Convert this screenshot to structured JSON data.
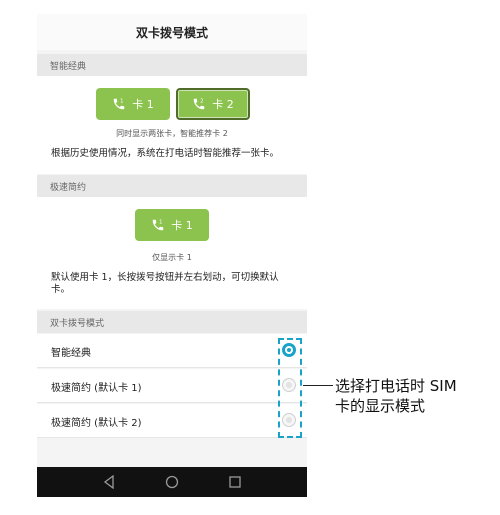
{
  "title": "双卡拨号模式",
  "sections": {
    "smart_classic": {
      "header": "智能经典",
      "card1_label": "卡 1",
      "card2_label": "卡 2",
      "caption": "同时显示两张卡，智能推荐卡 2",
      "description": "根据历史使用情况，系统在打电话时智能推荐一张卡。"
    },
    "fast_simple": {
      "header": "极速简约",
      "card1_label": "卡 1",
      "caption": "仅显示卡 1",
      "description": "默认使用卡 1，长按拨号按钮并左右划动，可切换默认卡。"
    },
    "mode": {
      "header": "双卡拨号模式",
      "options": [
        {
          "label": "智能经典",
          "selected": true
        },
        {
          "label": "极速简约 (默认卡 1)",
          "selected": false
        },
        {
          "label": "极速简约 (默认卡 2)",
          "selected": false
        }
      ]
    }
  },
  "callout": {
    "line1": "选择打电话时 SIM",
    "line2": "卡的显示模式"
  },
  "nav": {
    "back_icon": "back-triangle",
    "home_icon": "home-circle",
    "recent_icon": "recent-square"
  },
  "colors": {
    "sim_green": "#8cc34f",
    "accent_blue": "#1aa3c9"
  }
}
